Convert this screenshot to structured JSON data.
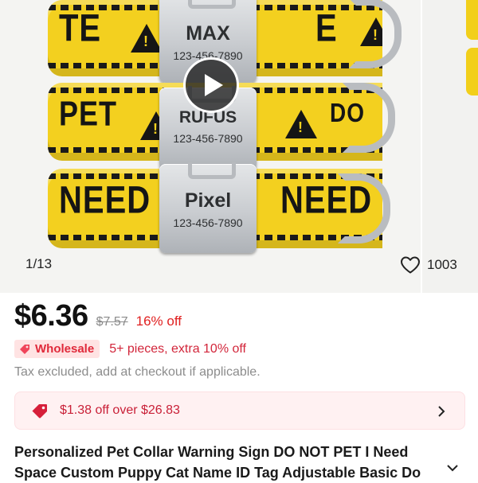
{
  "gallery": {
    "counter": "1/13",
    "favorites_count": "1003",
    "collars": [
      {
        "name": "MAX",
        "phone": "123-456-7890",
        "strap_text": "TE"
      },
      {
        "name": "RUFUS",
        "phone": "123-456-7890",
        "strap_text": "PET",
        "strap_text_right": "DO"
      },
      {
        "name": "Pixel",
        "phone": "123-456-7890",
        "strap_text": "NEED SPA",
        "strap_text_right": "NEED"
      }
    ],
    "play_icon": "play-icon",
    "heart_icon": "heart-outline-icon"
  },
  "price": {
    "current": "$6.36",
    "original": "$7.57",
    "discount": "16% off"
  },
  "wholesale": {
    "badge_label": "Wholesale",
    "note": "5+ pieces, extra 10% off",
    "icon": "tag-icon"
  },
  "tax_note": "Tax excluded, add at checkout if applicable.",
  "coupon": {
    "text": "$1.38 off over $26.83",
    "icon": "price-tag-icon"
  },
  "product": {
    "title_line1": "Personalized Pet Collar Warning Sign DO NOT PET I Need",
    "title_line2": "Space Custom Puppy Cat Name ID Tag Adjustable Basic Do"
  },
  "colors": {
    "accent_red": "#e02020",
    "coupon_bg": "#fff1f2",
    "collar_yellow": "#f3d01f",
    "wholesale_bg": "#ffe3e3"
  }
}
